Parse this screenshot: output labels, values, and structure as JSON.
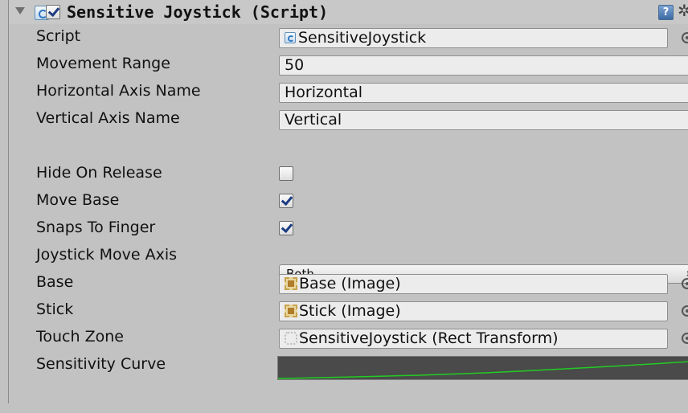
{
  "component": {
    "title": "Sensitive Joystick (Script)",
    "enabled": true,
    "expanded": true
  },
  "header_icons": {
    "help": "help-book-icon",
    "settings": "gear-dropdown-icon",
    "help_glyph": "?",
    "gear_glyph": "✲▾"
  },
  "properties": {
    "script": {
      "label": "Script",
      "value": "SensitiveJoystick"
    },
    "movement_range": {
      "label": "Movement Range",
      "value": "50"
    },
    "horizontal_axis": {
      "label": "Horizontal Axis Name",
      "value": "Horizontal"
    },
    "vertical_axis": {
      "label": "Vertical Axis Name",
      "value": "Vertical"
    },
    "hide_on_release": {
      "label": "Hide On Release",
      "checked": false
    },
    "move_base": {
      "label": "Move Base",
      "checked": true
    },
    "snaps_to_finger": {
      "label": "Snaps To Finger",
      "checked": true
    },
    "joystick_move_axis": {
      "label": "Joystick Move Axis",
      "value": "Both",
      "arrows": "⇕"
    },
    "base": {
      "label": "Base",
      "value": "Base (Image)"
    },
    "stick": {
      "label": "Stick",
      "value": "Stick (Image)"
    },
    "touch_zone": {
      "label": "Touch Zone",
      "value": "SensitiveJoystick (Rect Transform)"
    },
    "sensitivity_curve": {
      "label": "Sensitivity Curve"
    }
  },
  "colors": {
    "panel_bg": "#c2c2c2",
    "field_bg": "#ececec",
    "curve_bg": "#4a4a4a",
    "curve_line": "#22cc22"
  }
}
